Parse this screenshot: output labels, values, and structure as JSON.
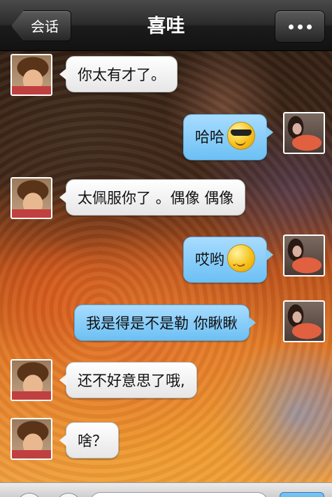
{
  "header": {
    "back_label": "会话",
    "title": "喜哇"
  },
  "messages": [
    {
      "side": "in",
      "text": "你太有才了。",
      "emoji": ""
    },
    {
      "side": "out",
      "text": "哈哈",
      "emoji": "cool-face-icon"
    },
    {
      "side": "in",
      "text": "太佩服你了 。偶像 偶像",
      "emoji": ""
    },
    {
      "side": "out",
      "text": "哎哟",
      "emoji": "shy-face-icon"
    },
    {
      "side": "out",
      "text": "我是得是不是勒  你瞅瞅",
      "emoji": ""
    },
    {
      "side": "in",
      "text": "还不好意思了哦,",
      "emoji": ""
    },
    {
      "side": "in",
      "text": "啥？",
      "emoji": ""
    }
  ],
  "colors": {
    "incoming_bubble": "#ffffff",
    "outgoing_bubble": "#86ccf6",
    "topbar": "#2b2b2b"
  }
}
